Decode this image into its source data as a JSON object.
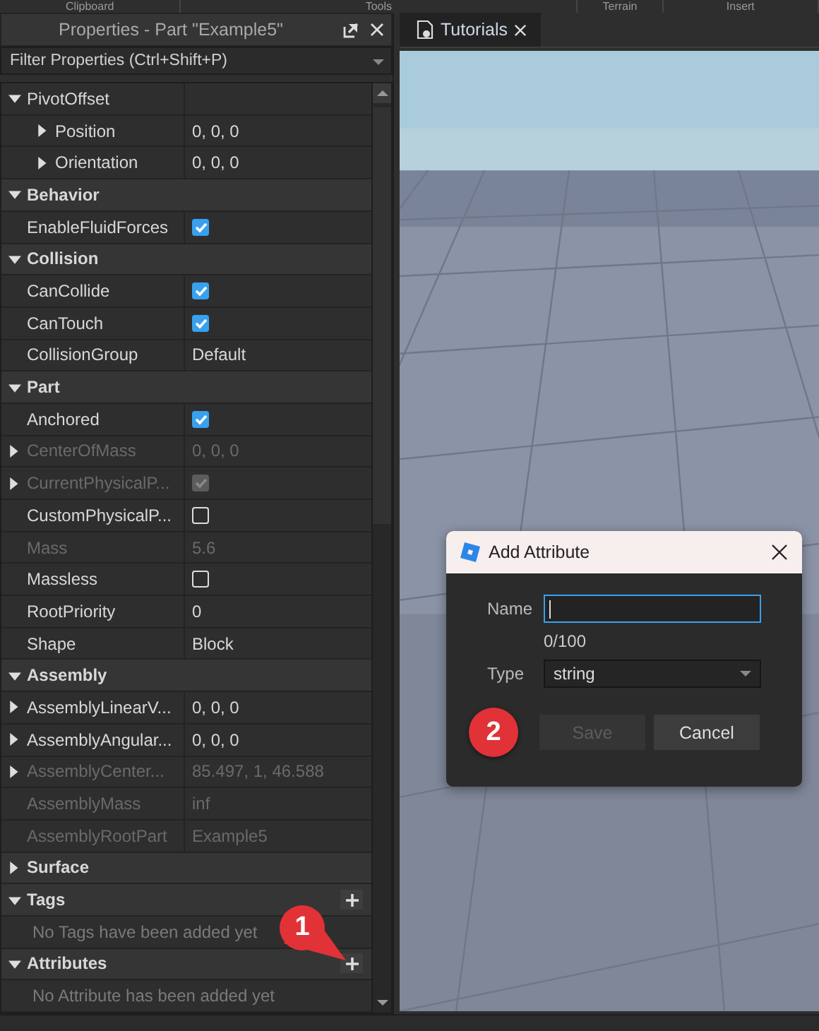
{
  "toolbar": [
    {
      "label": "Clipboard"
    },
    {
      "label": "Tools"
    },
    {
      "label": "Terrain"
    },
    {
      "label": "Insert"
    }
  ],
  "properties_panel": {
    "title": "Properties - Part \"Example5\"",
    "filter": {
      "placeholder": "Filter Properties (Ctrl+Shift+P)"
    },
    "rows": [
      {
        "kind": "property",
        "name": "PivotOffset",
        "disabled": false,
        "expanded": true,
        "children": [
          {
            "kind": "property",
            "name": "Position",
            "value": "0, 0, 0",
            "disabled": false,
            "expanded": false
          },
          {
            "kind": "property",
            "name": "Orientation",
            "value": "0, 0, 0",
            "disabled": false,
            "expanded": false
          }
        ]
      },
      {
        "kind": "section",
        "name": "Behavior",
        "expanded": true,
        "add_button": false,
        "children": [
          {
            "kind": "checkbox",
            "name": "EnableFluidForces",
            "checked": true,
            "disabled": false
          }
        ]
      },
      {
        "kind": "section",
        "name": "Collision",
        "expanded": true,
        "add_button": false,
        "children": [
          {
            "kind": "checkbox",
            "name": "CanCollide",
            "checked": true,
            "disabled": false
          },
          {
            "kind": "checkbox",
            "name": "CanTouch",
            "checked": true,
            "disabled": false
          },
          {
            "kind": "property",
            "name": "CollisionGroup",
            "value": "Default",
            "disabled": false
          }
        ]
      },
      {
        "kind": "section",
        "name": "Part",
        "expanded": true,
        "add_button": false,
        "children": [
          {
            "kind": "checkbox",
            "name": "Anchored",
            "checked": true,
            "disabled": false
          },
          {
            "kind": "property",
            "name": "CenterOfMass",
            "value": "0, 0, 0",
            "disabled": true,
            "expanded": false
          },
          {
            "kind": "checkbox",
            "name": "CurrentPhysicalP...",
            "checked": true,
            "disabled": true,
            "expanded": false
          },
          {
            "kind": "checkbox",
            "name": "CustomPhysicalP...",
            "checked": false,
            "disabled": false
          },
          {
            "kind": "property",
            "name": "Mass",
            "value": "5.6",
            "disabled": true
          },
          {
            "kind": "checkbox",
            "name": "Massless",
            "checked": false,
            "disabled": false
          },
          {
            "kind": "property",
            "name": "RootPriority",
            "value": "0",
            "disabled": false
          },
          {
            "kind": "property",
            "name": "Shape",
            "value": "Block",
            "disabled": false
          }
        ]
      },
      {
        "kind": "section",
        "name": "Assembly",
        "expanded": true,
        "add_button": false,
        "children": [
          {
            "kind": "property",
            "name": "AssemblyLinearV...",
            "value": "0, 0, 0",
            "disabled": false,
            "expanded": false
          },
          {
            "kind": "property",
            "name": "AssemblyAngular...",
            "value": "0, 0, 0",
            "disabled": false,
            "expanded": false
          },
          {
            "kind": "property",
            "name": "AssemblyCenter...",
            "value": "85.497, 1, 46.588",
            "disabled": true,
            "expanded": false
          },
          {
            "kind": "property",
            "name": "AssemblyMass",
            "value": "inf",
            "disabled": true
          },
          {
            "kind": "property",
            "name": "AssemblyRootPart",
            "value": "Example5",
            "disabled": true
          }
        ]
      },
      {
        "kind": "section",
        "name": "Surface",
        "expanded": false,
        "add_button": false
      },
      {
        "kind": "section",
        "name": "Tags",
        "expanded": true,
        "add_button": true,
        "children": [
          {
            "kind": "note",
            "text": "No Tags have been added yet"
          }
        ]
      },
      {
        "kind": "section",
        "name": "Attributes",
        "expanded": true,
        "add_button": true,
        "children": [
          {
            "kind": "note",
            "text": "No Attribute has been added yet"
          }
        ]
      }
    ]
  },
  "tabs": [
    {
      "label": "Tutorials",
      "selected": true
    }
  ],
  "dialog": {
    "title": "Add Attribute",
    "name_label": "Name",
    "counter": "0/100",
    "type_label": "Type",
    "type_value": "string",
    "buttons": [
      {
        "label": "Save",
        "disabled": true
      },
      {
        "label": "Cancel",
        "disabled": false
      }
    ]
  },
  "annotations": [
    {
      "text": "1",
      "kind": "pointer"
    },
    {
      "text": "2",
      "kind": "circle"
    }
  ]
}
